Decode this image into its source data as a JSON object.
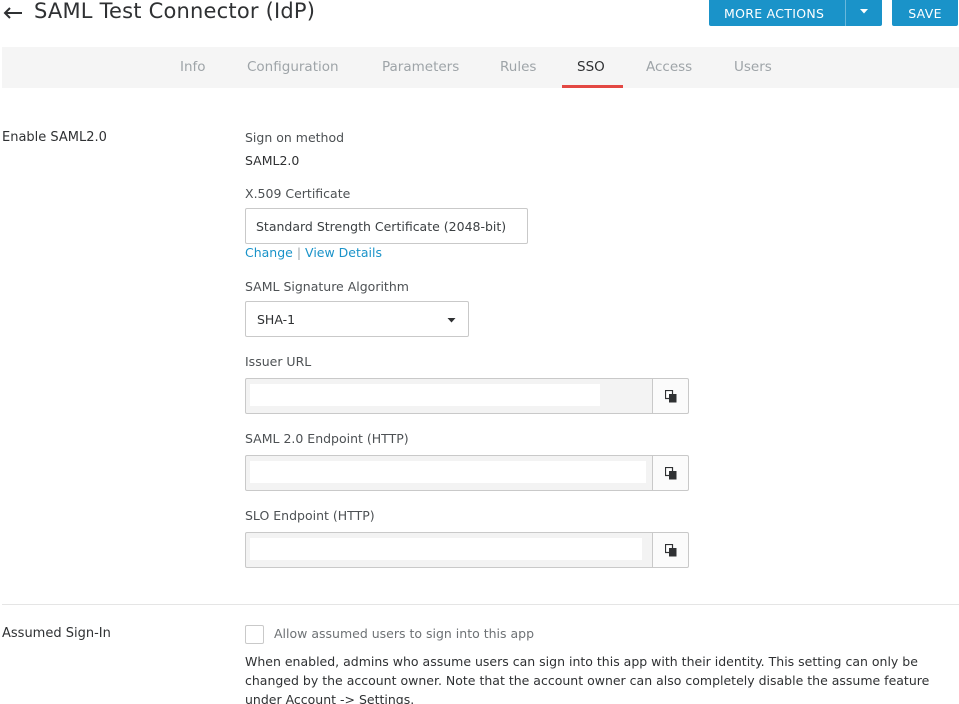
{
  "header": {
    "title": "SAML Test Connector (IdP)",
    "more_actions_label": "MORE ACTIONS",
    "save_label": "SAVE"
  },
  "tabs": [
    {
      "label": "Info"
    },
    {
      "label": "Configuration"
    },
    {
      "label": "Parameters"
    },
    {
      "label": "Rules"
    },
    {
      "label": "SSO",
      "active": true
    },
    {
      "label": "Access"
    },
    {
      "label": "Users"
    }
  ],
  "enable_saml": {
    "section_label": "Enable SAML2.0",
    "sign_on_method_label": "Sign on method",
    "sign_on_method_value": "SAML2.0",
    "certificate_label": "X.509 Certificate",
    "certificate_value": "Standard Strength Certificate (2048-bit)",
    "change_link": "Change",
    "separator": "|",
    "view_details_link": "View Details",
    "algorithm_label": "SAML Signature Algorithm",
    "algorithm_value": "SHA-1",
    "issuer_url_label": "Issuer URL",
    "issuer_url_value": "",
    "saml_endpoint_label": "SAML 2.0 Endpoint (HTTP)",
    "saml_endpoint_value": "",
    "slo_endpoint_label": "SLO Endpoint (HTTP)",
    "slo_endpoint_value": ""
  },
  "assumed_sign_in": {
    "section_label": "Assumed Sign-In",
    "checkbox_label": "Allow assumed users to sign into this app",
    "checked": false,
    "help_text": "When enabled, admins who assume users can sign into this app with their identity. This setting can only be changed by the account owner. Note that the account owner can also completely disable the assume feature under Account -> Settings."
  },
  "colors": {
    "primary_button": "#1a93c9",
    "link": "#1a93c9",
    "active_tab_underline": "#e34843",
    "tab_bar_bg": "#f5f5f5"
  },
  "icons": {
    "back": "arrow-left-icon",
    "more_actions_toggle": "caret-down-icon",
    "algorithm_dropdown": "caret-down-icon",
    "copy": "clipboard-copy-icon"
  }
}
